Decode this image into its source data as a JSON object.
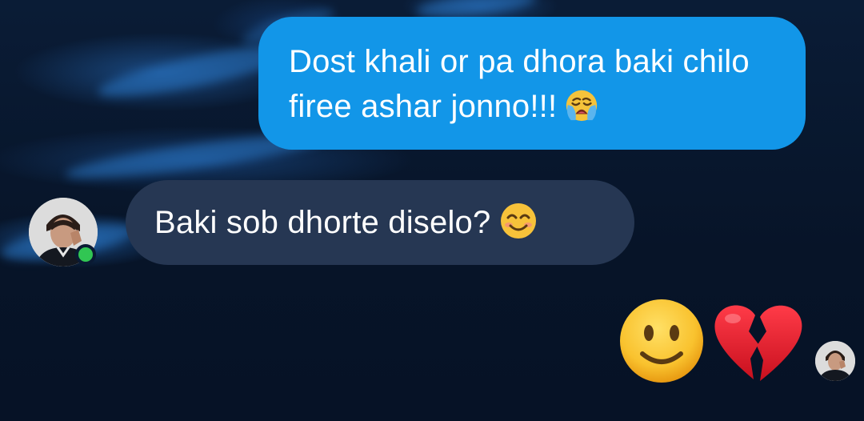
{
  "conversation": {
    "messages": [
      {
        "direction": "outgoing",
        "text": "Dost khali or pa dhora baki chilo firee ashar jonno!!!",
        "emoji": "loudly-crying-face"
      },
      {
        "direction": "incoming",
        "text": "Baki sob dhorte diselo?",
        "emoji": "smiling-face-with-smiling-eyes"
      }
    ],
    "reaction_message": {
      "direction": "outgoing",
      "emojis": [
        "slightly-smiling-face",
        "broken-heart"
      ]
    }
  },
  "contact": {
    "online": true,
    "online_color": "#31c653"
  },
  "colors": {
    "outgoing_bubble": "#1296e8",
    "incoming_bubble": "#263753",
    "background": "#07152b"
  }
}
